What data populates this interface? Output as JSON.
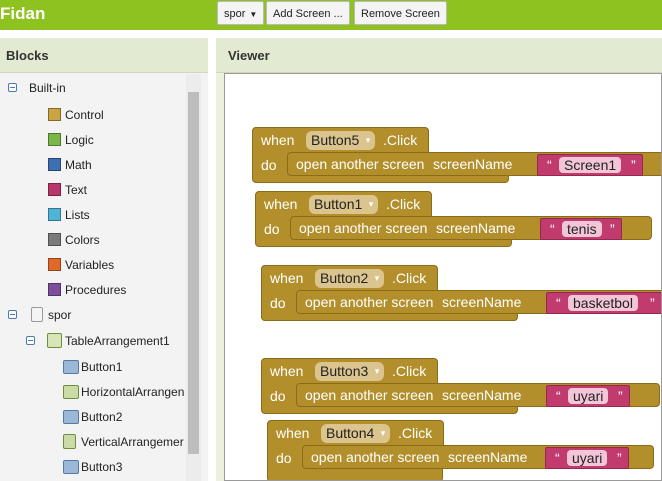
{
  "app": {
    "title": "Fidan"
  },
  "toolbar": {
    "screen_select": "spor",
    "add_screen": "Add Screen ...",
    "remove_screen": "Remove Screen"
  },
  "blocks_panel": {
    "title": "Blocks",
    "builtin": {
      "label": "Built-in",
      "items": [
        {
          "label": "Control",
          "color": "#c9a442"
        },
        {
          "label": "Logic",
          "color": "#7ab648"
        },
        {
          "label": "Math",
          "color": "#3d6fb5"
        },
        {
          "label": "Text",
          "color": "#b7376a"
        },
        {
          "label": "Lists",
          "color": "#4fb4d8"
        },
        {
          "label": "Colors",
          "color": "#7a7a7a"
        },
        {
          "label": "Variables",
          "color": "#e0692a"
        },
        {
          "label": "Procedures",
          "color": "#7d4e9a"
        }
      ]
    },
    "screen": {
      "label": "spor",
      "arrangement": "TableArrangement1",
      "components": [
        "Button1",
        "HorizontalArrangen",
        "Button2",
        "VerticalArrangemer",
        "Button3"
      ]
    }
  },
  "viewer": {
    "title": "Viewer",
    "keywords": {
      "when": "when",
      "do": "do",
      "click": ".Click",
      "open": "open another screen",
      "screen_name": "screenName",
      "quote": "“",
      "quote_close": "”"
    },
    "blocks": [
      {
        "component": "Button5",
        "value": "Screen1"
      },
      {
        "component": "Button1",
        "value": "tenis"
      },
      {
        "component": "Button2",
        "value": "basketbol"
      },
      {
        "component": "Button3",
        "value": "uyari"
      },
      {
        "component": "Button4",
        "value": "uyari"
      }
    ]
  }
}
